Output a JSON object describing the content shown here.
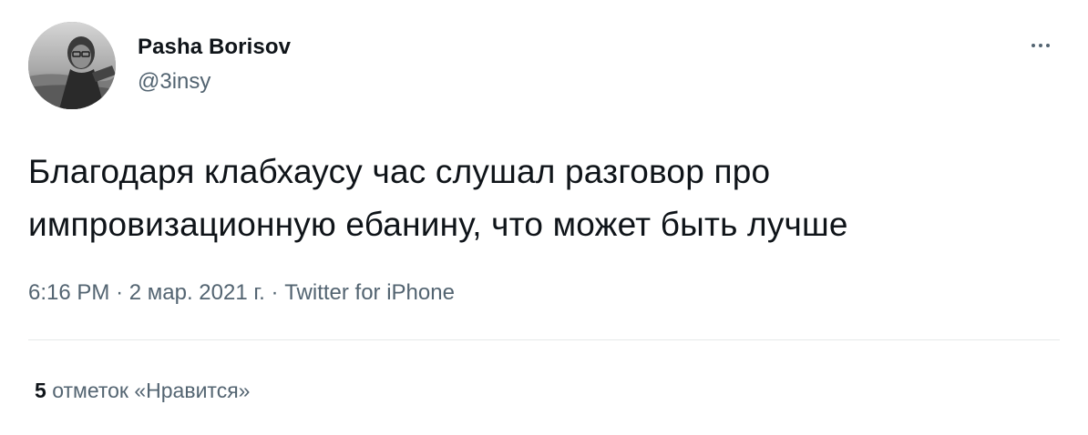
{
  "tweet": {
    "author": {
      "display_name": "Pasha Borisov",
      "handle": "@3insy",
      "avatar_icon": "profile-photo"
    },
    "more_icon": "more-horizontal-icon",
    "text_line_1": "Благодаря клабхаусу час слушал разговор про",
    "text_line_2": "импровизационную ебанину, что может быть лучше",
    "time": "6:16 PM",
    "separator": "·",
    "date": "2 мар. 2021 г.",
    "source": "Twitter for iPhone",
    "likes": {
      "count": "5",
      "label": "отметок «Нравится»"
    }
  },
  "colors": {
    "text_primary": "#0f1419",
    "text_secondary": "#536471",
    "divider": "#e6e9ea",
    "background": "#ffffff"
  }
}
